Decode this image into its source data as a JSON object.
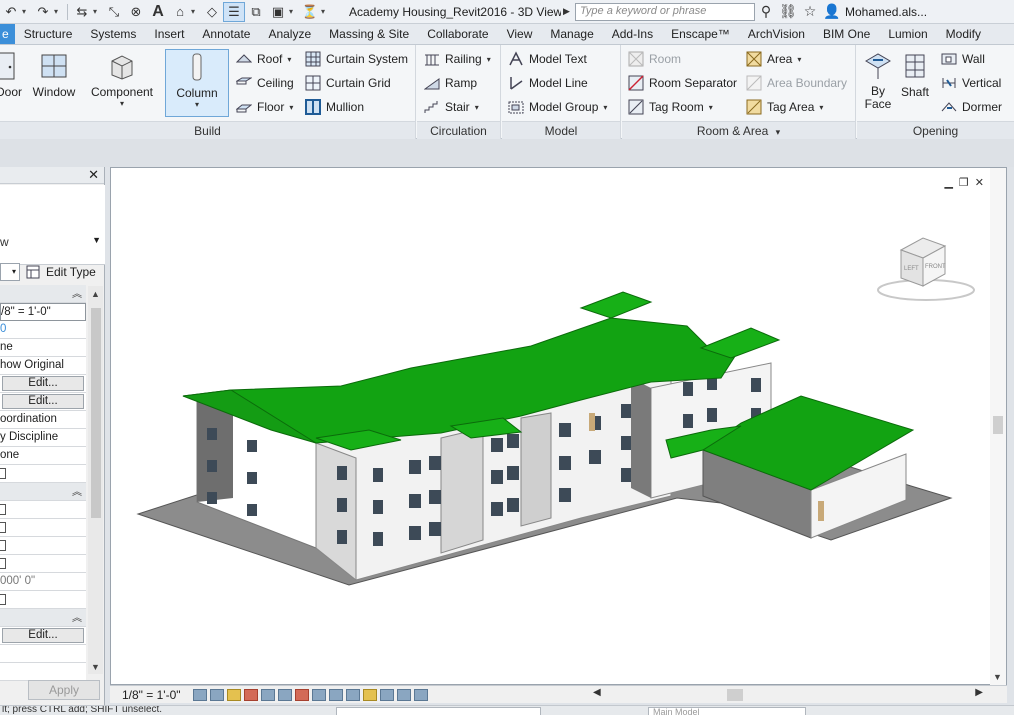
{
  "titlebar": {
    "document_title": "Academy Housing_Revit2016 - 3D View...",
    "search_placeholder": "Type a keyword or phrase",
    "user_name": "Mohamed.als..."
  },
  "tabs": [
    {
      "label": "e"
    },
    {
      "label": "Structure"
    },
    {
      "label": "Systems"
    },
    {
      "label": "Insert"
    },
    {
      "label": "Annotate"
    },
    {
      "label": "Analyze"
    },
    {
      "label": "Massing & Site"
    },
    {
      "label": "Collaborate"
    },
    {
      "label": "View"
    },
    {
      "label": "Manage"
    },
    {
      "label": "Add-Ins"
    },
    {
      "label": "Enscape™"
    },
    {
      "label": "ArchVision"
    },
    {
      "label": "BIM One"
    },
    {
      "label": "Lumion"
    },
    {
      "label": "Modify"
    }
  ],
  "ribbon": {
    "build": {
      "label": "Build",
      "door": "Door",
      "window": "Window",
      "component": "Component",
      "column": "Column",
      "roof": "Roof",
      "ceiling": "Ceiling",
      "floor": "Floor",
      "curtain_system": "Curtain System",
      "curtain_grid": "Curtain Grid",
      "mullion": "Mullion"
    },
    "circulation": {
      "label": "Circulation",
      "railing": "Railing",
      "ramp": "Ramp",
      "stair": "Stair"
    },
    "model": {
      "label": "Model",
      "model_text": "Model Text",
      "model_line": "Model Line",
      "model_group": "Model Group"
    },
    "room_area": {
      "label": "Room & Area",
      "room": "Room",
      "room_separator": "Room Separator",
      "tag_room": "Tag Room",
      "area": "Area",
      "area_boundary": "Area Boundary",
      "tag_area": "Tag Area"
    },
    "opening": {
      "label": "Opening",
      "by_face_1": "By",
      "by_face_2": "Face",
      "shaft": "Shaft",
      "wall": "Wall",
      "vertical": "Vertical",
      "dormer": "Dormer"
    }
  },
  "properties": {
    "type_selector_value": "w",
    "edit_type": "Edit Type",
    "rows": {
      "scale": "/8\" = 1'-0\"",
      "r2": "0",
      "r3": "ne",
      "r4": "how Original",
      "btn1": "Edit...",
      "btn2": "Edit...",
      "r7": "oordination",
      "r8": "y Discipline",
      "r9": "one",
      "r10": "000' 0\"",
      "btn3": "Edit..."
    },
    "apply": "Apply"
  },
  "viewbar": {
    "scale": "1/8\" = 1'-0\""
  },
  "viewcube": {
    "left_face": "LEFT",
    "front_face": "FRONT"
  },
  "statusbar": {
    "text": "lt; press CTRL add; SHIFT unselect.",
    "model_field": "Main Model"
  },
  "colors": {
    "roof_green": "#12a312",
    "active_tab": "#3c8fd9",
    "ground_gray": "#8c8c8c"
  }
}
